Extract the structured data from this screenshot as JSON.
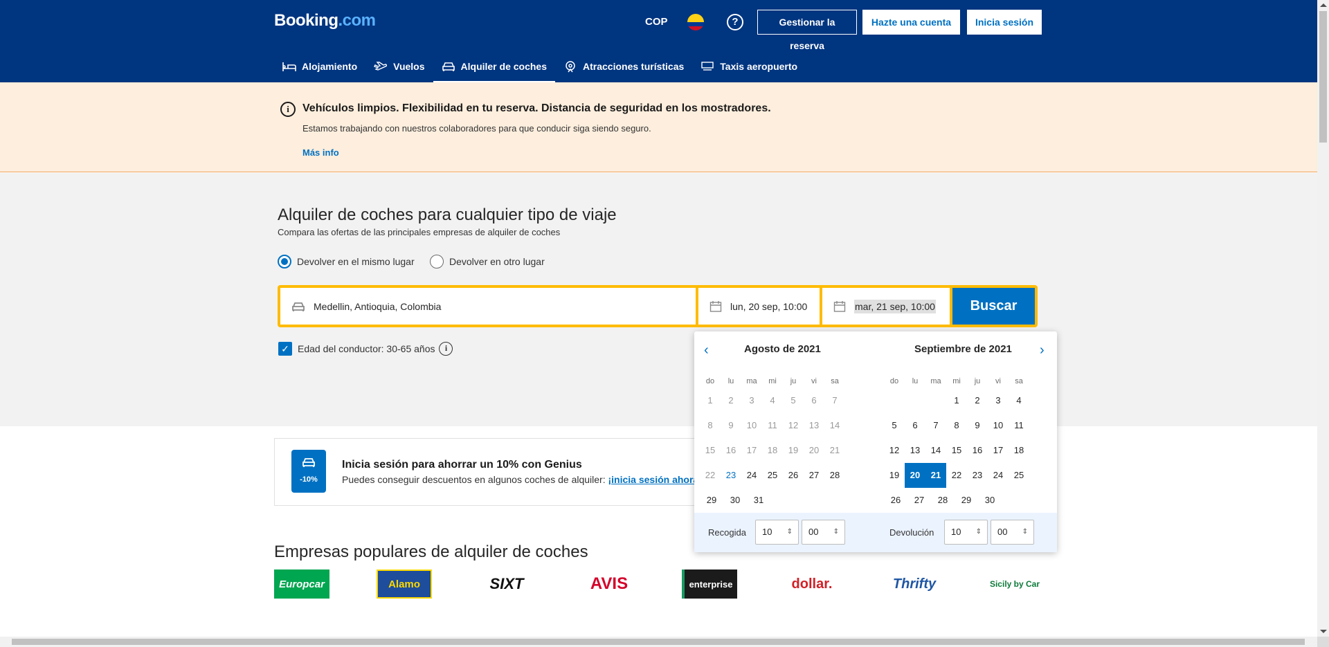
{
  "header": {
    "logo_main": "Booking",
    "logo_dot": ".com",
    "currency": "COP",
    "help": "?",
    "manage": "Gestionar la reserva",
    "register": "Hazte una cuenta",
    "signin": "Inicia sesión"
  },
  "nav": [
    {
      "label": "Alojamiento",
      "icon": "bed-icon"
    },
    {
      "label": "Vuelos",
      "icon": "plane-icon"
    },
    {
      "label": "Alquiler de coches",
      "icon": "car-icon",
      "active": true
    },
    {
      "label": "Atracciones turísticas",
      "icon": "attractions-icon"
    },
    {
      "label": "Taxis aeropuerto",
      "icon": "taxi-icon"
    }
  ],
  "banner": {
    "title": "Vehículos limpios. Flexibilidad en tu reserva. Distancia de seguridad en los mostradores.",
    "subtitle": "Estamos trabajando con nuestros colaboradores para que conducir siga siendo seguro.",
    "link": "Más info"
  },
  "hero": {
    "title": "Alquiler de coches para cualquier tipo de viaje",
    "subtitle": "Compara las ofertas de las principales empresas de alquiler de coches",
    "radio_same": "Devolver en el mismo lugar",
    "radio_other": "Devolver en otro lugar",
    "location": "Medellin, Antioquia, Colombia",
    "pickup_date": "lun, 20 sep, 10:00",
    "return_date": "mar, 21 sep, 10:00",
    "search": "Buscar",
    "age": "Edad del conductor: 30-65 años"
  },
  "calendar": {
    "month_left": "Agosto de 2021",
    "month_right": "Septiembre de 2021",
    "weekdays": [
      "do",
      "lu",
      "ma",
      "mi",
      "ju",
      "vi",
      "sa"
    ],
    "pickup_label": "Recogida",
    "return_label": "Devolución",
    "pickup_hour": "10",
    "pickup_min": "00",
    "return_hour": "10",
    "return_min": "00"
  },
  "genius": {
    "badge": "-10%",
    "title": "Inicia sesión para ahorrar un 10% con Genius",
    "subtitle": "Puedes conseguir descuentos en algunos coches de alquiler: ",
    "link": "¡inicia sesión ahora!"
  },
  "popular_title": "Empresas populares de alquiler de coches",
  "brands": [
    "Europcar",
    "Alamo",
    "SIXT",
    "AVIS",
    "enterprise",
    "dollar.",
    "Thrifty",
    "Sicily by Car"
  ],
  "colors": {
    "brand_blue": "#003580",
    "accent": "#0071c2",
    "yellow": "#febb02",
    "banner": "#fdeedd"
  }
}
